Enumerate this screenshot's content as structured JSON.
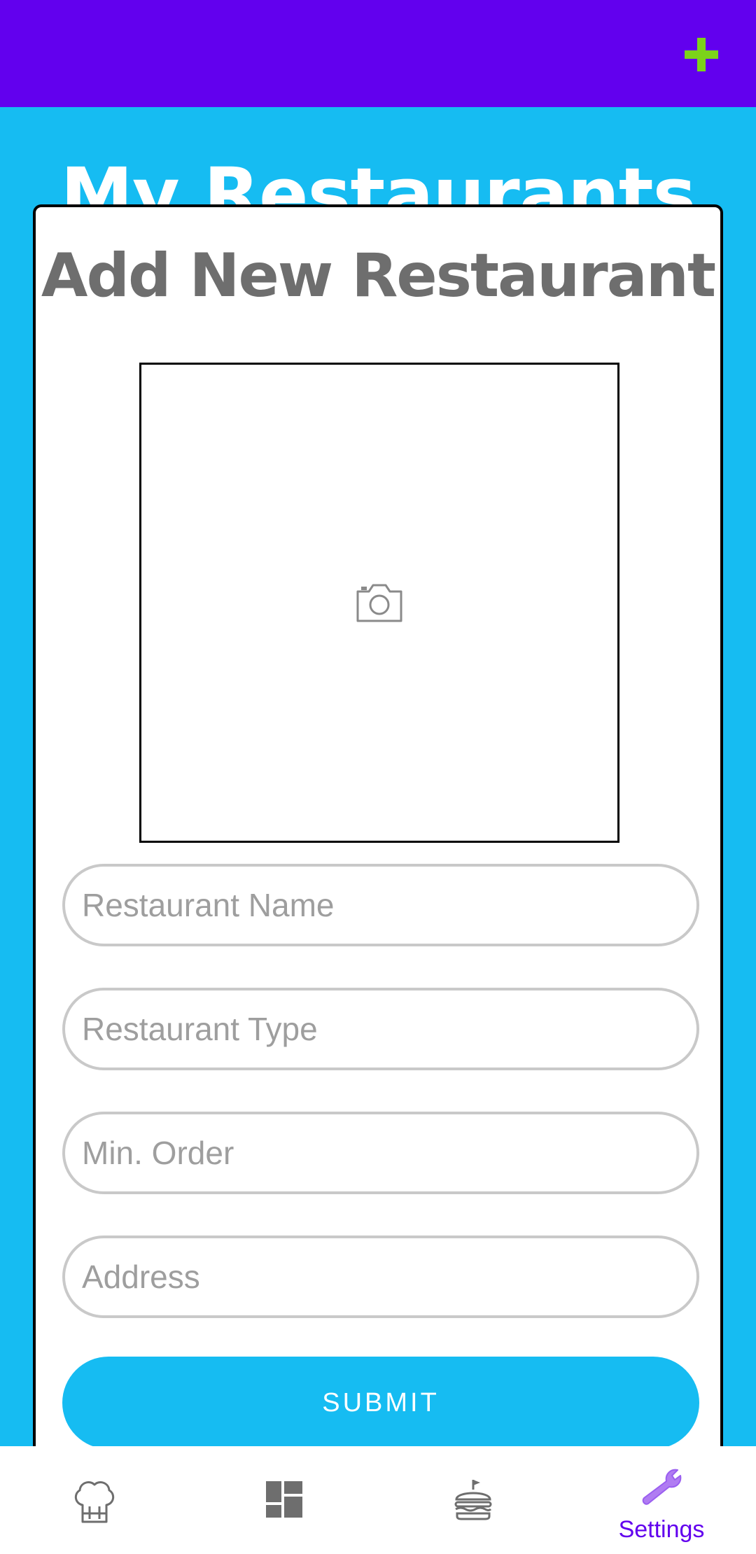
{
  "header": {
    "add_icon": "plus-icon",
    "add_color": "#7cd31a",
    "background": "#6200ee"
  },
  "page": {
    "title": "My Restaurants",
    "background": "#16bcf2"
  },
  "dialog": {
    "title": "Add New Restaurant",
    "photo_icon": "camera-icon",
    "fields": [
      {
        "placeholder": "Restaurant Name",
        "value": ""
      },
      {
        "placeholder": "Restaurant Type",
        "value": ""
      },
      {
        "placeholder": "Min. Order",
        "value": ""
      },
      {
        "placeholder": "Address",
        "value": ""
      }
    ],
    "submit_label": "SUBMIT"
  },
  "bottom_nav": {
    "items": [
      {
        "icon": "chef-hat-icon",
        "label": ""
      },
      {
        "icon": "dashboard-icon",
        "label": ""
      },
      {
        "icon": "burger-icon",
        "label": ""
      },
      {
        "icon": "wrench-icon",
        "label": "Settings",
        "active": true
      }
    ],
    "active_color": "#6200ee",
    "inactive_color": "#6e6e6e"
  }
}
